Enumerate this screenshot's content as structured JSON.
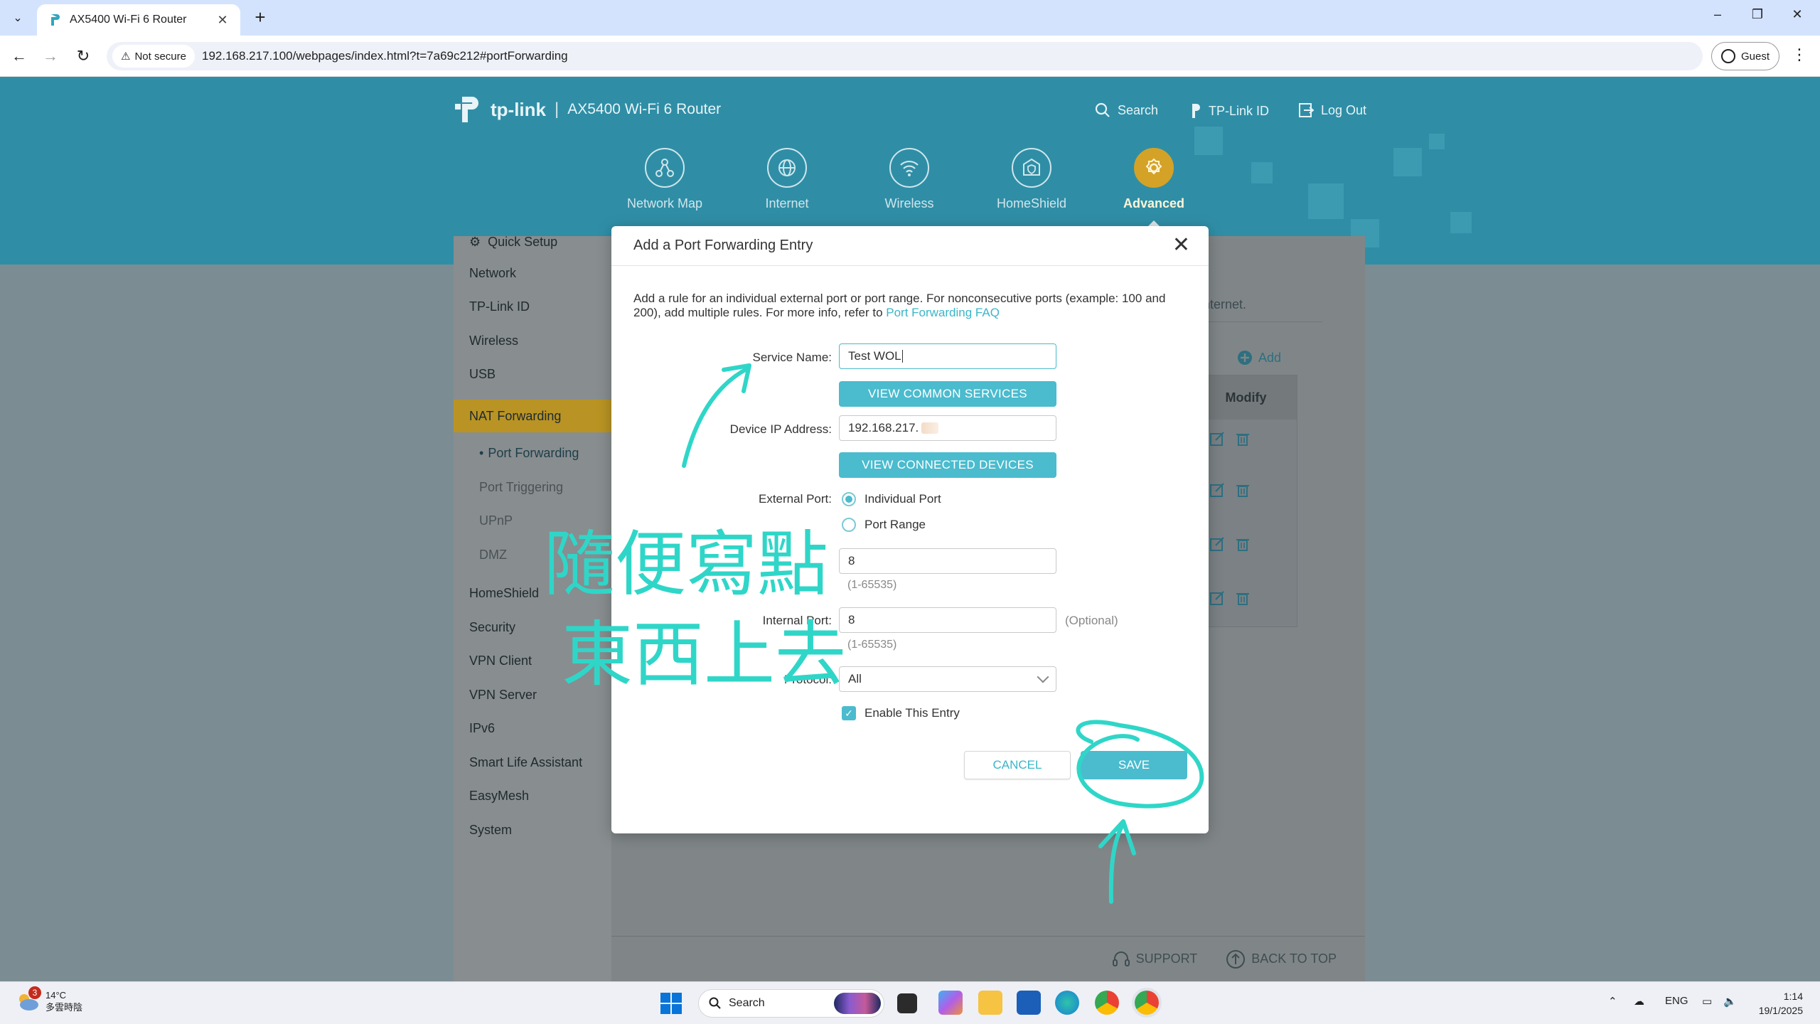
{
  "browser": {
    "tab_title": "AX5400 Wi-Fi 6 Router",
    "security_label": "Not secure",
    "url": "192.168.217.100/webpages/index.html?t=7a69c212#portForwarding",
    "profile_label": "Guest"
  },
  "router": {
    "brand": "tp-link",
    "model": "AX5400 Wi-Fi 6 Router",
    "header_links": {
      "search": "Search",
      "tplink_id": "TP-Link ID",
      "logout": "Log Out"
    },
    "nav": {
      "network_map": "Network Map",
      "internet": "Internet",
      "wireless": "Wireless",
      "homeshield": "HomeShield",
      "advanced": "Advanced"
    },
    "sidebar": {
      "quick_setup": "Quick Setup",
      "network": "Network",
      "tplink_id": "TP-Link ID",
      "wireless": "Wireless",
      "usb": "USB",
      "nat_forwarding": "NAT Forwarding",
      "port_forwarding": "Port Forwarding",
      "port_triggering": "Port Triggering",
      "upnp": "UPnP",
      "dmz": "DMZ",
      "homeshield": "HomeShield",
      "security": "Security",
      "vpn_client": "VPN Client",
      "vpn_server": "VPN Server",
      "ipv6": "IPv6",
      "smart_life": "Smart Life Assistant",
      "easymesh": "EasyMesh",
      "system": "System"
    },
    "content": {
      "internet_fragment": "nternet.",
      "add_label": "Add",
      "modify_header": "Modify"
    },
    "footer": {
      "support": "SUPPORT",
      "back_to_top": "BACK TO TOP"
    }
  },
  "modal": {
    "title": "Add a Port Forwarding Entry",
    "description": "Add a rule for an individual external port or port range. For nonconsecutive ports (example: 100 and 200), add multiple rules. For more info, refer to ",
    "faq_link": "Port Forwarding FAQ",
    "service_name_label": "Service Name:",
    "service_name_value": "Test WOL",
    "view_common_services": "VIEW COMMON SERVICES",
    "device_ip_label": "Device IP Address:",
    "device_ip_value": "192.168.217.",
    "view_connected_devices": "VIEW CONNECTED DEVICES",
    "external_port_label": "External Port:",
    "individual_port": "Individual Port",
    "port_range": "Port Range",
    "external_port_value": "8",
    "external_port_hint": "(1-65535)",
    "internal_port_label": "Internal Port:",
    "internal_port_value": "8",
    "internal_port_hint": "(1-65535)",
    "internal_optional": "(Optional)",
    "protocol_label": "Protocol:",
    "protocol_value": "All",
    "enable_entry": "Enable This Entry",
    "cancel": "CANCEL",
    "save": "SAVE"
  },
  "annotation": {
    "handwriting_line1": "隨便寫點",
    "handwriting_line2": "東西上去",
    "color": "#2fd6c8"
  },
  "taskbar": {
    "weather_badge": "3",
    "temperature": "14°C",
    "weather_desc": "多雲時陰",
    "search_label": "Search",
    "lang": "ENG",
    "time": "1:14",
    "date": "19/1/2025"
  },
  "colors": {
    "teal_accent": "#4bbbce",
    "header_teal": "#2f8ea6",
    "active_gold": "#d4a227"
  }
}
